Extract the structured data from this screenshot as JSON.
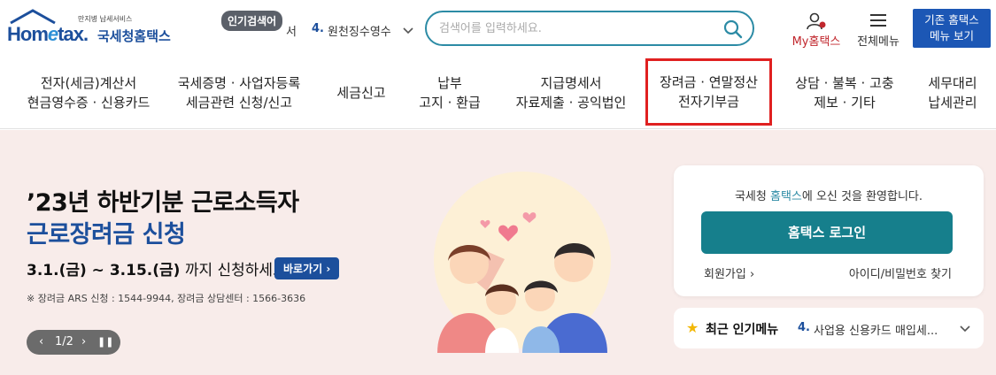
{
  "logo": {
    "sub": "만지병 납세서비스",
    "main_pre": "Hom",
    "main_e": "e",
    "main_post": "tax.",
    "korean": "국세청홈택스"
  },
  "popular": {
    "badge": "인기검색어",
    "prefix": "서",
    "num": "4.",
    "text": "원천징수영수",
    "chevron": "chevron-down-icon"
  },
  "search": {
    "placeholder": "검색어를 입력하세요."
  },
  "utility": {
    "myhome_my": "My",
    "myhome_rest": "홈택스",
    "allmenu": "전체메뉴",
    "old_menu_line1": "기존 홈택스",
    "old_menu_line2": "메뉴 보기"
  },
  "nav": {
    "items": [
      {
        "line1": "전자(세금)계산서",
        "line2": "현금영수증 · 신용카드"
      },
      {
        "line1": "국세증명 · 사업자등록",
        "line2": "세금관련 신청/신고"
      },
      {
        "line1": "세금신고",
        "line2": ""
      },
      {
        "line1": "납부",
        "line2": "고지 · 환급"
      },
      {
        "line1": "지급명세서",
        "line2": "자료제출 · 공익법인"
      },
      {
        "line1": "장려금 · 연말정산",
        "line2": "전자기부금"
      },
      {
        "line1": "상담 · 불복 · 고충",
        "line2": "제보 · 기타"
      },
      {
        "line1": "세무대리",
        "line2": "납세관리"
      }
    ],
    "highlight_color": "#e02020"
  },
  "hero": {
    "title1": "’23년 하반기분 근로소득자",
    "title2": "근로장려금 신청",
    "date_bold": "3.1.(금) ~ 3.15.(금)",
    "date_rest": " 까지 신청하세요!",
    "go_button": "바로가기",
    "note": "※ 장려금 ARS 신청 : 1544-9944, 장려금 상담센터 : 1566-3636",
    "pager_text": "1/2",
    "pager_prev": "‹",
    "pager_next": "›",
    "pager_pause": "⏸"
  },
  "login": {
    "welcome_pre": "국세청 ",
    "welcome_brand": "홈택스",
    "welcome_post": "에 오신 것을 환영합니다.",
    "login_button": "홈택스 로그인",
    "join": "회원가입",
    "find": "아이디/비밀번호 찾기"
  },
  "recent": {
    "title": "최근 인기메뉴",
    "num": "4.",
    "text": "사업용 신용카드 매입세..."
  },
  "colors": {
    "brand_blue": "#1c4f9c",
    "teal": "#167f8c",
    "hero_bg": "#f8ecea"
  }
}
